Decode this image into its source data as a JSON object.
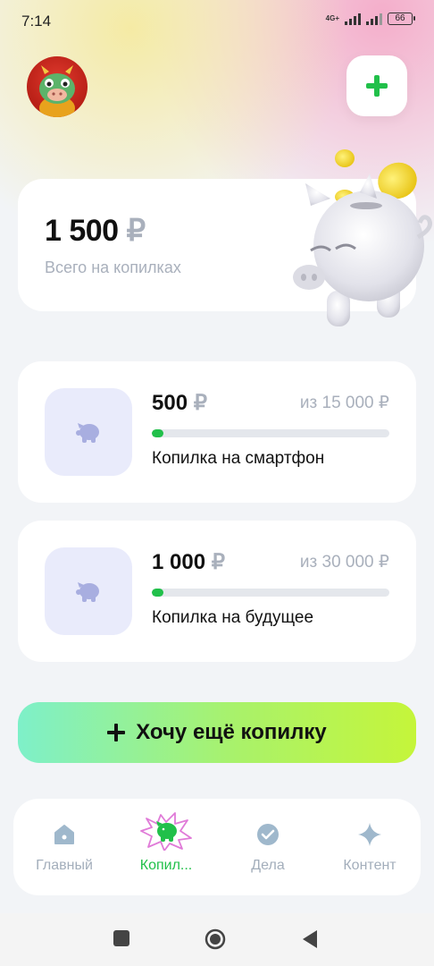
{
  "status_bar": {
    "time": "7:14",
    "network": "4G+",
    "battery": "66"
  },
  "header": {
    "avatar_icon": "dragon-avatar-icon",
    "add_icon": "plus-icon"
  },
  "summary": {
    "amount": "1 500",
    "currency": "₽",
    "label": "Всего на копилках"
  },
  "piggies": [
    {
      "amount": "500",
      "currency": "₽",
      "goal": "из 15 000 ₽",
      "name": "Копилка на смартфон",
      "progress": 0.05
    },
    {
      "amount": "1 000",
      "currency": "₽",
      "goal": "из 30 000 ₽",
      "name": "Копилка на будущее",
      "progress": 0.05
    }
  ],
  "cta": {
    "label": "Хочу ещё копилку"
  },
  "nav": {
    "items": [
      {
        "label": "Главный",
        "icon": "home-icon",
        "active": false
      },
      {
        "label": "Копил...",
        "icon": "piggy-bank-icon",
        "active": true
      },
      {
        "label": "Дела",
        "icon": "check-circle-icon",
        "active": false
      },
      {
        "label": "Контент",
        "icon": "sparkle-icon",
        "active": false
      }
    ]
  },
  "colors": {
    "accent_green": "#21c04a",
    "muted_text": "#a9b0bc",
    "thumb_bg": "#e9ebfb"
  }
}
